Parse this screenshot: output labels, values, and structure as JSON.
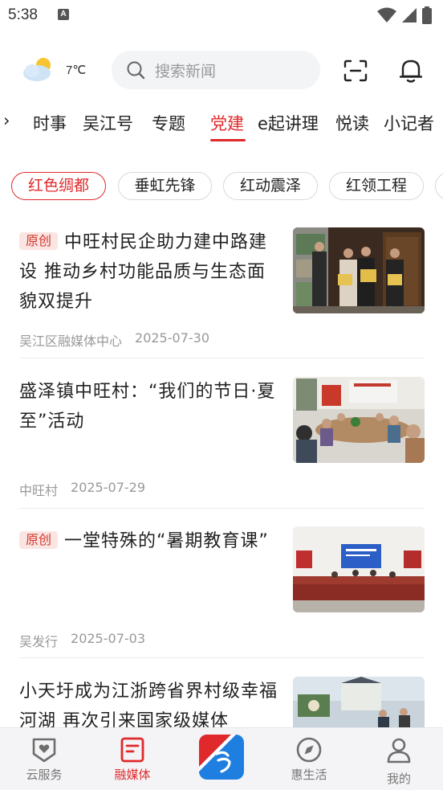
{
  "status_bar": {
    "time": "5:38",
    "notif_glyph": "A"
  },
  "header": {
    "temperature": "7℃",
    "search_placeholder": "搜索新闻",
    "icons": [
      "weather-icon",
      "search-icon",
      "scan-icon",
      "bell-icon"
    ]
  },
  "tabs": {
    "items": [
      "›",
      "时事",
      "吴江号",
      "专题",
      "党建",
      "e起讲理",
      "悦读",
      "小记者"
    ],
    "active": "党建"
  },
  "chips": {
    "items": [
      "红色绸都",
      "垂虹先锋",
      "红动震泽",
      "红领工程"
    ],
    "active": "红色绸都"
  },
  "articles": [
    {
      "badge": "原创",
      "title": "中旺村民企助力建中路建设  推动乡村功能品质与生态面貌双提升",
      "source": "吴江区融媒体中心",
      "date": "2025-07-30"
    },
    {
      "badge": "",
      "title": "盛泽镇中旺村：“我们的节日·夏至”活动",
      "source": "中旺村",
      "date": "2025-07-29"
    },
    {
      "badge": "原创",
      "title": "一堂特殊的“暑期教育课”",
      "source": "吴发行",
      "date": "2025-07-03"
    },
    {
      "badge": "",
      "title": "小天圩成为江浙跨省界村级幸福河湖  再次引来国家级媒体",
      "source": "",
      "date": ""
    }
  ],
  "bottom_nav": {
    "items": [
      {
        "label": "云服务",
        "icon": "shield-heart-icon"
      },
      {
        "label": "融媒体",
        "icon": "document-icon"
      },
      {
        "label": "",
        "icon": "app-logo"
      },
      {
        "label": "惠生活",
        "icon": "compass-icon"
      },
      {
        "label": "我的",
        "icon": "user-icon"
      }
    ],
    "active": "融媒体"
  },
  "colors": {
    "accent": "#e0292b",
    "badge_bg": "#fbe5e3",
    "meta": "#999999",
    "logo_blue": "#1e7fe0"
  }
}
